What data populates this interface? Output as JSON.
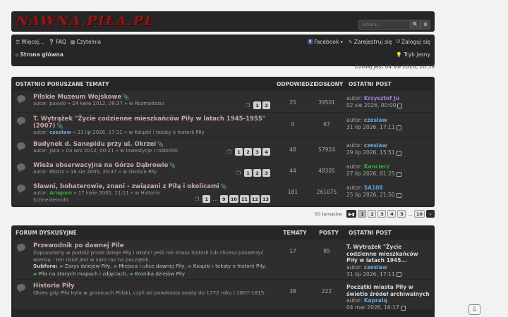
{
  "header": {
    "logo_text": "NAWNA.PIŁA.PL",
    "search_placeholder": "Szukaj…",
    "search_icon": "search-icon",
    "advanced_icon": "gear-icon"
  },
  "nav": {
    "more": "Więcej…",
    "faq": "FAQ",
    "reading": "Czytelnia",
    "facebook": "Facebook",
    "register": "Zarejestruj się",
    "login": "Zaloguj się",
    "home": "Strona główna",
    "night": "Tryb jasny"
  },
  "date_line": "Dzisiaj jest 04 sie 2026, 20:59",
  "recent": {
    "header": {
      "title": "OSTATNIO PORUSZANE TEMATY",
      "replies": "ODPOWIEDZI",
      "views": "ODSŁONY",
      "last": "OSTATNI POST"
    },
    "topics": [
      {
        "title": "Pilskie Muzeum Wojskowe",
        "meta_author": "pavvlo",
        "meta_date": "24 kwie 2012, 08:37",
        "meta_forum": "Rozmaitości",
        "pages": [
          "1",
          "2"
        ],
        "replies": "25",
        "views": "39501",
        "last_label": "autor:",
        "last_author": "Krzysztof Ju",
        "last_date": "02 sie 2026, 00:00"
      },
      {
        "title": "T. Wytrążek \"Życie codzienne mieszkańców Piły w latach 1945-1955\" (2007)",
        "meta_author": "czeslaw",
        "meta_date": "31 lip 2026, 17:11",
        "meta_forum": "Książki i teksty o historii Piły",
        "pages": [],
        "replies": "0",
        "views": "67",
        "last_label": "autor:",
        "last_author": "czeslaw",
        "last_date": "31 lip 2026, 17:11"
      },
      {
        "title": "Budynek d. Sanepidu przy ul. Okrzei",
        "meta_author": "Jaca",
        "meta_date": "03 wrz 2012, 00:21",
        "meta_forum": "Inwestycje i rozbiórki",
        "pages": [
          "1",
          "2",
          "3",
          "4"
        ],
        "replies": "48",
        "views": "57924",
        "last_label": "autor:",
        "last_author": "czeslaw",
        "last_date": "29 lip 2026, 15:51"
      },
      {
        "title": "Wieża obserwacyjna na Górze Dąbrowie",
        "meta_author": "Mistrz",
        "meta_date": "16 sie 2005, 20:47",
        "meta_forum": "Okolice Piły",
        "pages": [
          "1",
          "2",
          "3"
        ],
        "replies": "44",
        "views": "48305",
        "last_label": "autor:",
        "last_author": "Kancierz",
        "last_date": "27 lip 2026, 01:25"
      },
      {
        "title": "Sławni, bohaterowie, znani - związani z Piłą i okolicami",
        "meta_author": "Aragorn",
        "meta_date": "17 kwie 2005, 11:11",
        "meta_forum": "Historia Schneidemühl",
        "pages": [
          "1",
          "…",
          "9",
          "10",
          "11",
          "12",
          "13"
        ],
        "replies": "181",
        "views": "261075",
        "last_label": "autor:",
        "last_author": "SA108",
        "last_date": "25 lip 2026, 21:50"
      }
    ]
  },
  "pagination": {
    "count": "50 tematów",
    "pages": [
      "1",
      "2",
      "3",
      "4",
      "5",
      "…",
      "10"
    ],
    "next": "›"
  },
  "forums": {
    "header": {
      "title": "FORUM DYSKUSYJNE",
      "topics": "TEMATY",
      "posts": "POSTY",
      "last": "OSTATNI POST"
    },
    "items": [
      {
        "title": "Przewodnik po dawnej Pile",
        "desc": "Zapraszamy w podróż przez dzieje Piły i okolic! Jeśli nie znasz historii lub chcesz poszerzyć wiedzę - ten dział jest w sam raz na początek.",
        "subs_label": "Subfora:",
        "subs": [
          "Zarys dziejów Piły,",
          "Miejsca i ulice dawnej Piły,",
          "Książki i teksty o historii Piły,",
          "Piła na starych mapach i zdjęciach,",
          "Kronika dziejów Piły"
        ],
        "topics": "17",
        "posts": "85",
        "last_title": "T. Wytrążek \"Życie codzienne mieszkańców Piły w latach 1945...",
        "last_author": "czeslaw",
        "last_date": "31 lip 2026, 17:11"
      },
      {
        "title": "Historia Piły",
        "desc": "Okres gdy Piła była w granicach Polski, czyli od powstania osady do 1772 roku i 1807-1815.",
        "subs_label": "",
        "subs": [],
        "topics": "38",
        "posts": "222",
        "last_title": "Początki miasta Piły w świetle źródeł archiwalnych",
        "last_author": "Kapralq",
        "last_date": "04 mar 2026, 16:17"
      }
    ]
  },
  "labels": {
    "author": "autor:",
    "in": "w",
    "sep": "»"
  }
}
